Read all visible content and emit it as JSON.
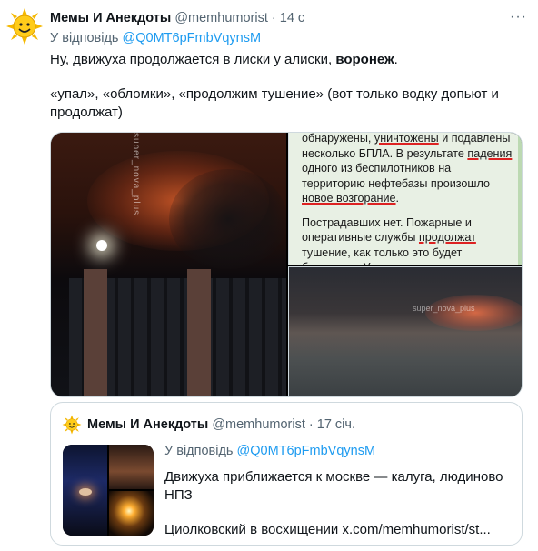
{
  "tweet": {
    "author_name": "Мемы И Анекдоты",
    "handle": "@memhumorist",
    "separator": "·",
    "time": "14 с",
    "more_label": "···",
    "reply_prefix": "У відповідь",
    "reply_mention": "@Q0MT6pFmbVqynsM",
    "text_line1_a": "Ну, движуха продолжается в лиски у алиски, ",
    "text_line1_bold": "воронеж",
    "text_line1_end": ".",
    "text_line2": "«упал», «обломки», «продолжим тушение» (вот только водку допьют и продолжат)"
  },
  "media": {
    "left_watermark": "super_nova_plus",
    "doc": {
      "p1_a": "обнаружены, ",
      "p1_ul1": "уничтожены",
      "p1_b": " и подавлены несколько БПЛА. В результате ",
      "p1_ul2": "падения",
      "p1_c": " одного из беспилотников на территорию нефтебазы произошло ",
      "p1_ul3": "новое возгорание",
      "p1_d": ".",
      "p2_a": "Пострадавших нет. Пожарные и оперативные службы ",
      "p2_ul": "продолжат",
      "p2_b": " тушение, как только это будет безопасно. Угрозы населению нет."
    },
    "bottom_watermark": "super_nova_plus"
  },
  "quote": {
    "author_name": "Мемы И Анекдоты",
    "handle": "@memhumorist",
    "separator": "·",
    "time": "17 січ.",
    "reply_prefix": "У відповідь",
    "reply_mention": "@Q0MT6pFmbVqynsM",
    "text_line1": "Движуха приближается к москве — калуга, людиново НПЗ",
    "text_line2_a": "Циолковский в восхищении ",
    "text_link": "x.com/memhumorist/st..."
  },
  "colors": {
    "accent": "#1d9bf0",
    "secondary_text": "#536471",
    "border": "#cfd9de",
    "underline": "#dd2222"
  }
}
